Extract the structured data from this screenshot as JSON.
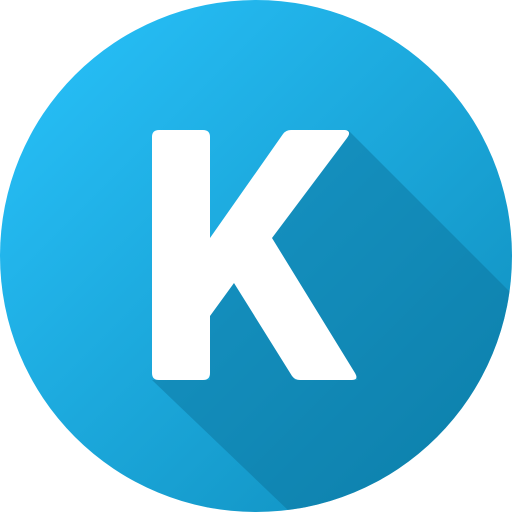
{
  "icon": {
    "letter": "K",
    "colors": {
      "circle_light": "#29c3fc",
      "circle_dark": "#0e8cba",
      "shadow": "#0a6f96",
      "letter": "#ffffff"
    }
  }
}
